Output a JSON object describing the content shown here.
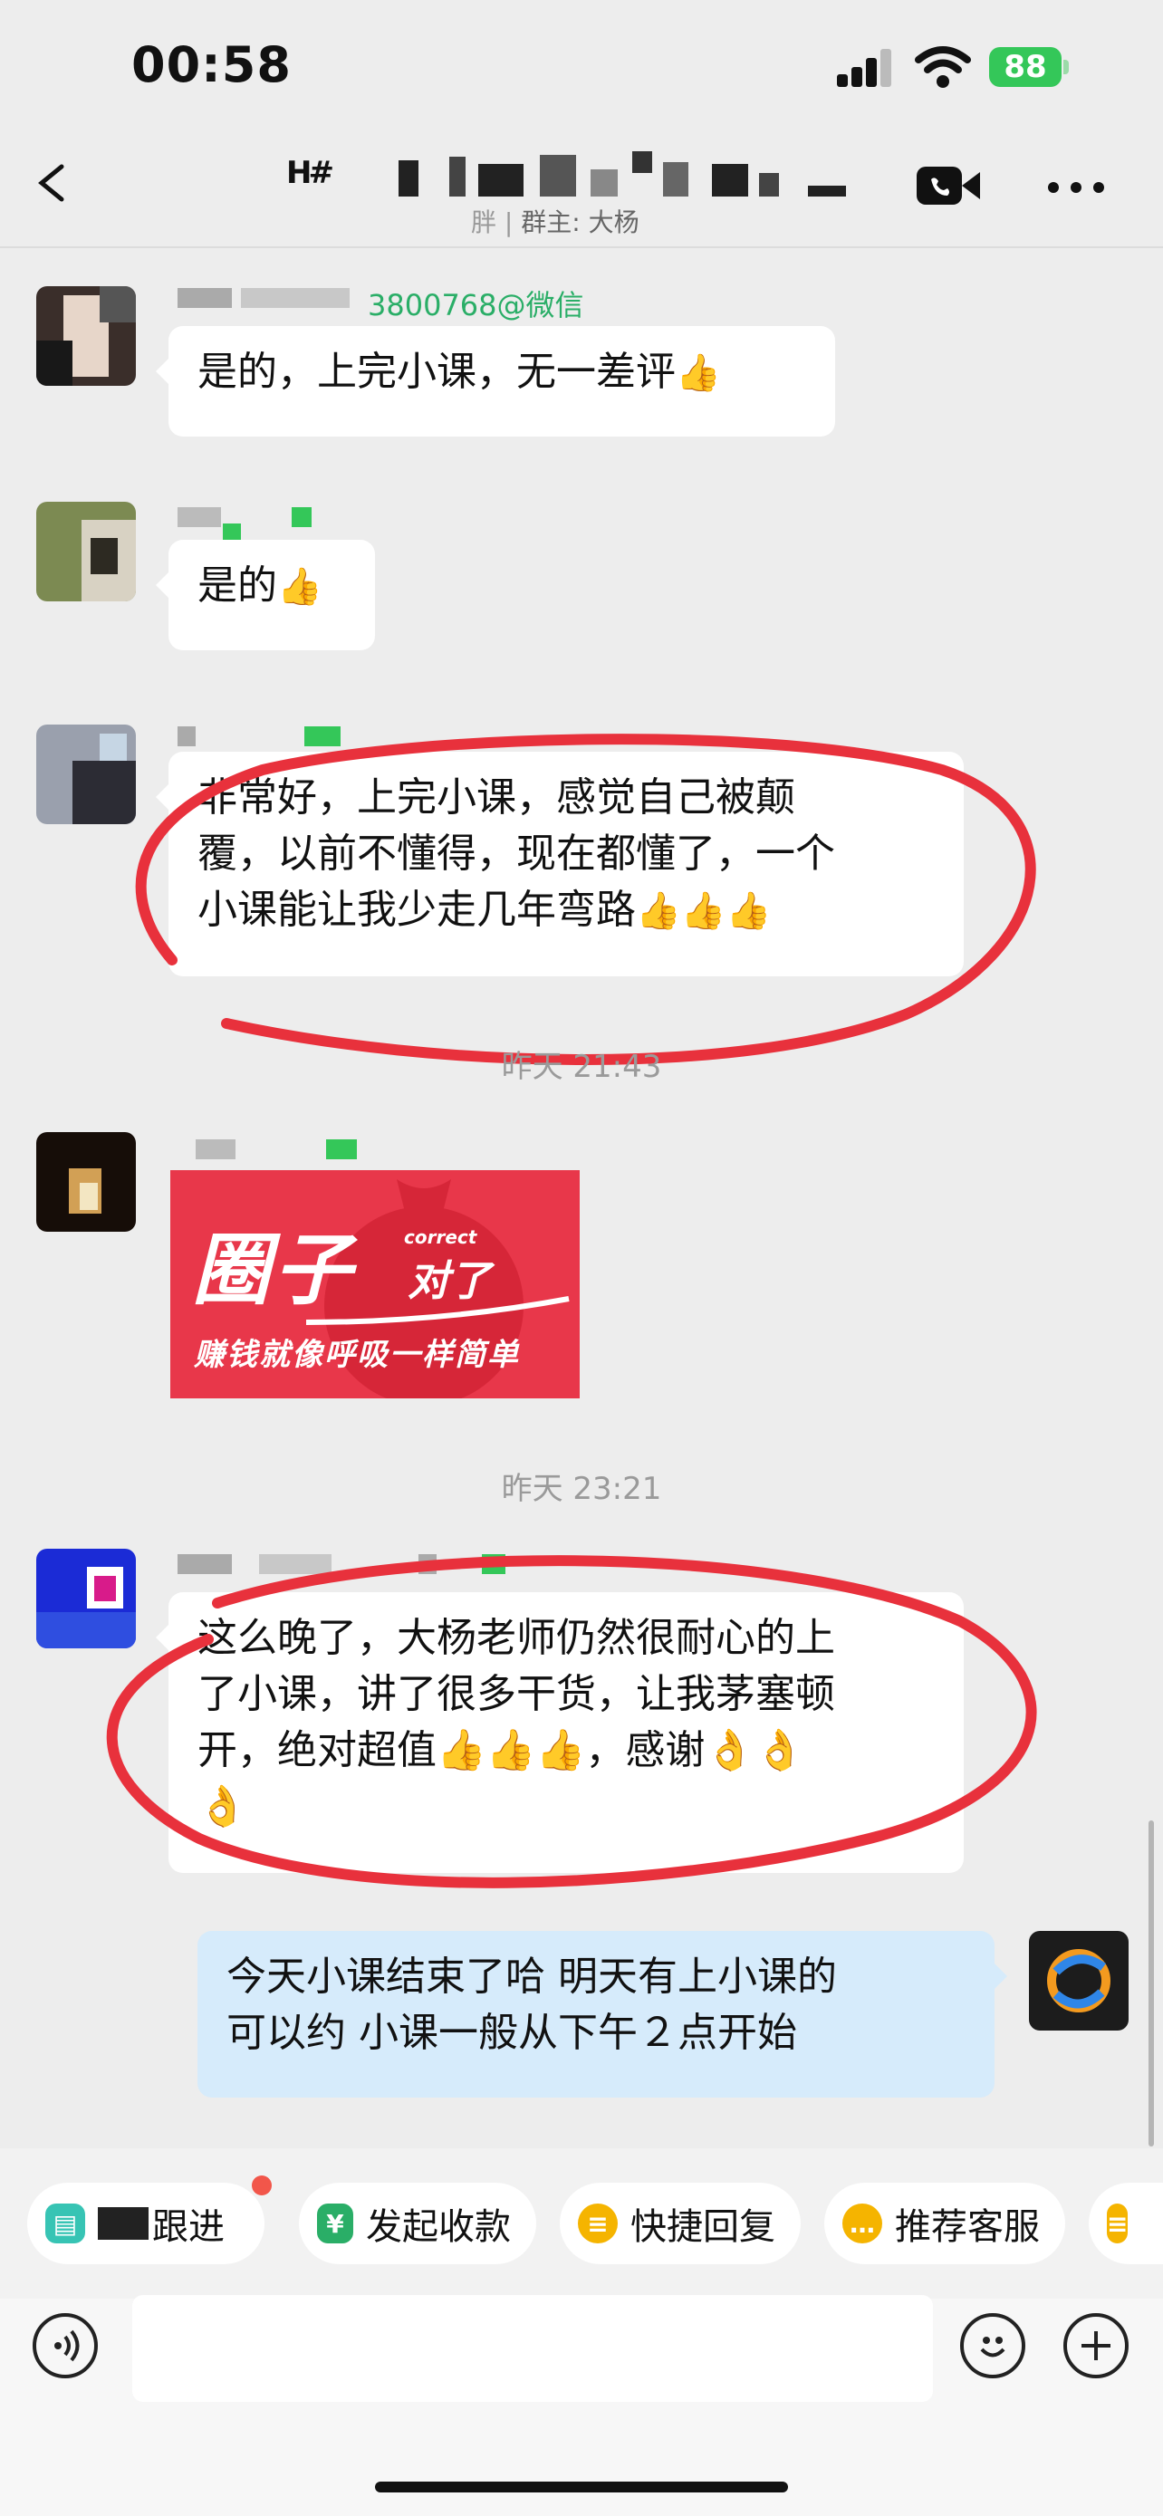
{
  "status_bar": {
    "time": "00:58",
    "battery": "88"
  },
  "header": {
    "title_obscured": "H#",
    "subtitle": "群主: 大杨",
    "subtitle_prefix": "胖 |"
  },
  "messages": [
    {
      "sender_suffix": "3800768@微信",
      "text": "是的，上完小课，无一差评",
      "emoji": "👍"
    },
    {
      "text": "是的",
      "emoji": "👍"
    },
    {
      "text_lines": [
        "非常好，上完小课，感觉自己被颠",
        "覆，以前不懂得，现在都懂了，一个",
        "小课能让我少走几年弯路"
      ],
      "emoji": "👍👍👍"
    },
    {
      "promo": {
        "title": "圈子",
        "correct": "correct",
        "dui": "对了",
        "slogan": "赚钱就像呼吸一样简单"
      }
    },
    {
      "text_lines": [
        "这么晚了，大杨老师仍然很耐心的上",
        "了小课，讲了很多干货，让我茅塞顿",
        "开，绝对超值👍👍👍，感谢👌👌",
        "👌"
      ]
    },
    {
      "mine": true,
      "text_lines": [
        "今天小课结束了哈 明天有上小课的",
        "可以约 小课一般从下午２点开始"
      ]
    }
  ],
  "timestamps": [
    "昨天 21:43",
    "昨天 23:21"
  ],
  "chips": {
    "follow": "跟进",
    "payment": "发起收款",
    "quick_reply": "快捷回复",
    "recommend": "推荐客服"
  },
  "colors": {
    "annotation": "#e8313c",
    "mine_bubble": "#d6ebfb",
    "wechat_green": "#2aae67",
    "battery": "#34c759"
  }
}
